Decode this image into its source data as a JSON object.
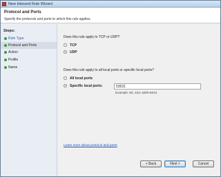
{
  "window": {
    "title": "New Inbound Rule Wizard"
  },
  "header": {
    "title": "Protocol and Ports",
    "subtitle": "Specify the protocols and ports to which this rule applies."
  },
  "sidebar": {
    "steps_label": "Steps:",
    "items": [
      {
        "label": "Rule Type"
      },
      {
        "label": "Protocol and Ports"
      },
      {
        "label": "Action"
      },
      {
        "label": "Profile"
      },
      {
        "label": "Name"
      }
    ]
  },
  "protocol": {
    "question": "Does this rule apply to TCP or UDP?",
    "options": [
      {
        "label": "TCP",
        "selected": false
      },
      {
        "label": "UDP",
        "selected": true
      }
    ]
  },
  "ports": {
    "question": "Does this rule apply to all local ports or specific local ports?",
    "all_label": "All local ports",
    "specific_label": "Specific local ports:",
    "value": "53531",
    "example": "Example: 80, 443, 5000-5010"
  },
  "link": {
    "learn_more": "Learn more about protocol and ports"
  },
  "buttons": {
    "back": "< Back",
    "next": "Next >",
    "cancel": "Cancel"
  }
}
